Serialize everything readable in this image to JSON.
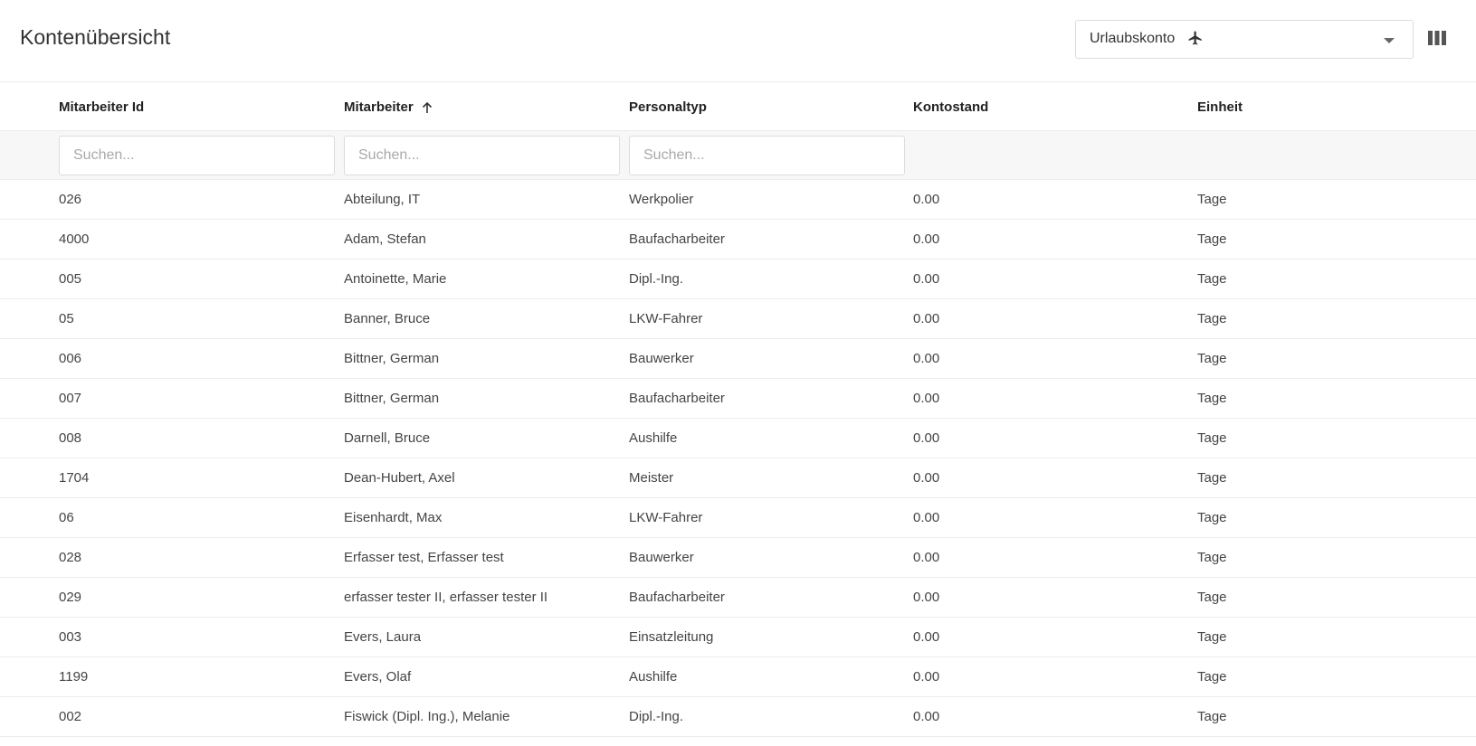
{
  "header": {
    "title": "Kontenübersicht",
    "account_select": {
      "value": "Urlaubskonto",
      "icon": "airplane-icon"
    },
    "columns_icon": "columns-icon"
  },
  "table": {
    "columns": [
      {
        "label": "Mitarbeiter Id"
      },
      {
        "label": "Mitarbeiter",
        "sort": "ascending"
      },
      {
        "label": "Personaltyp"
      },
      {
        "label": "Kontostand"
      },
      {
        "label": "Einheit"
      }
    ],
    "filters": [
      {
        "placeholder": "Suchen...",
        "value": ""
      },
      {
        "placeholder": "Suchen...",
        "value": ""
      },
      {
        "placeholder": "Suchen...",
        "value": ""
      }
    ],
    "rows": [
      [
        "026",
        "Abteilung, IT",
        "Werkpolier",
        "0.00",
        "Tage"
      ],
      [
        "4000",
        "Adam, Stefan",
        "Baufacharbeiter",
        "0.00",
        "Tage"
      ],
      [
        "005",
        "Antoinette, Marie",
        "Dipl.-Ing.",
        "0.00",
        "Tage"
      ],
      [
        "05",
        "Banner, Bruce",
        "LKW-Fahrer",
        "0.00",
        "Tage"
      ],
      [
        "006",
        "Bittner, German",
        "Bauwerker",
        "0.00",
        "Tage"
      ],
      [
        "007",
        "Bittner, German",
        "Baufacharbeiter",
        "0.00",
        "Tage"
      ],
      [
        "008",
        "Darnell, Bruce",
        "Aushilfe",
        "0.00",
        "Tage"
      ],
      [
        "1704",
        "Dean-Hubert, Axel",
        "Meister",
        "0.00",
        "Tage"
      ],
      [
        "06",
        "Eisenhardt, Max",
        "LKW-Fahrer",
        "0.00",
        "Tage"
      ],
      [
        "028",
        "Erfasser test, Erfasser test",
        "Bauwerker",
        "0.00",
        "Tage"
      ],
      [
        "029",
        "erfasser tester II, erfasser tester II",
        "Baufacharbeiter",
        "0.00",
        "Tage"
      ],
      [
        "003",
        "Evers, Laura",
        "Einsatzleitung",
        "0.00",
        "Tage"
      ],
      [
        "1199",
        "Evers, Olaf",
        "Aushilfe",
        "0.00",
        "Tage"
      ],
      [
        "002",
        "Fiswick (Dipl. Ing.), Melanie",
        "Dipl.-Ing.",
        "0.00",
        "Tage"
      ]
    ]
  },
  "colors": {
    "text": "#333333",
    "muted_placeholder": "#a9a9a9",
    "border": "#ececec",
    "filter_row_bg": "#f7f7f7"
  }
}
